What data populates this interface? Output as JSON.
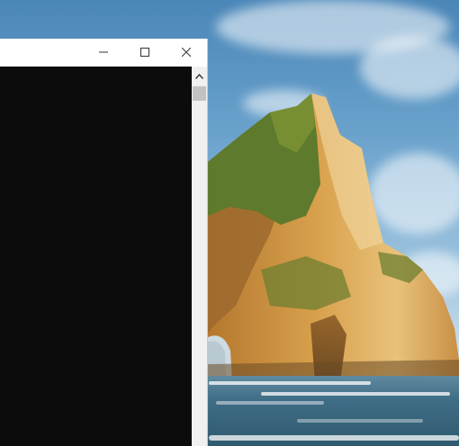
{
  "window": {
    "title": "",
    "caption_buttons": [
      {
        "name": "minimize",
        "icon": "minimize-icon"
      },
      {
        "name": "maximize",
        "icon": "maximize-icon"
      },
      {
        "name": "close",
        "icon": "close-icon"
      }
    ],
    "console_text": ""
  },
  "scrollbar": {
    "up_icon": "scroll-up-arrow-icon"
  },
  "desktop": {
    "wallpaper": "coastal-rock-arch",
    "colors": {
      "sky": "#6aa2cc",
      "rock_light": "#d9a24e",
      "grass": "#5e7a2c",
      "sea": "#3f6d85",
      "console_bg": "#0c0c0c"
    }
  }
}
